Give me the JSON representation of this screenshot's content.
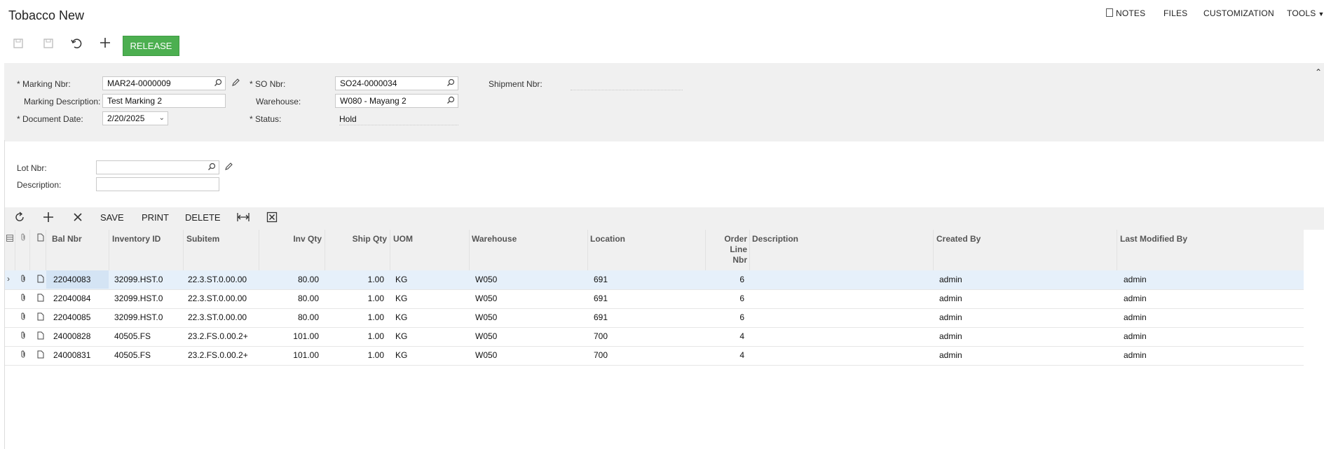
{
  "app": {
    "title": "Tobacco New"
  },
  "top_links": {
    "notes": "NOTES",
    "files": "FILES",
    "customization": "CUSTOMIZATION",
    "tools": "TOOLS"
  },
  "toolbar": {
    "release": "RELEASE"
  },
  "form": {
    "marking_nbr": {
      "label": "Marking Nbr:",
      "value": "MAR24-0000009"
    },
    "marking_desc": {
      "label": "Marking Description:",
      "value": "Test Marking 2"
    },
    "document_date": {
      "label": "Document Date:",
      "value": "2/20/2025"
    },
    "so_nbr": {
      "label": "SO Nbr:",
      "value": "SO24-0000034"
    },
    "warehouse": {
      "label": "Warehouse:",
      "value": "W080 - Mayang 2"
    },
    "status": {
      "label": "Status:",
      "value": "Hold"
    },
    "shipment_nbr": {
      "label": "Shipment Nbr:",
      "value": ""
    },
    "required_mark": "*"
  },
  "filter": {
    "lot_nbr": {
      "label": "Lot Nbr:",
      "value": ""
    },
    "description": {
      "label": "Description:",
      "value": ""
    }
  },
  "grid_toolbar": {
    "save": "SAVE",
    "print": "PRINT",
    "delete": "DELETE"
  },
  "columns": {
    "bal_nbr": "Bal Nbr",
    "inventory_id": "Inventory ID",
    "subitem": "Subitem",
    "inv_qty": "Inv Qty",
    "ship_qty": "Ship Qty",
    "uom": "UOM",
    "warehouse": "Warehouse",
    "location": "Location",
    "order_line_1": "Order",
    "order_line_2": "Line",
    "order_line_3": "Nbr",
    "description": "Description",
    "created_by": "Created By",
    "last_modified_by": "Last Modified By"
  },
  "rows": [
    {
      "bal_nbr": "22040083",
      "inventory_id": "32099.HST.0",
      "subitem": "22.3.ST.0.00.00",
      "inv_qty": "80.00",
      "ship_qty": "1.00",
      "uom": "KG",
      "warehouse": "W050",
      "location": "691",
      "order_line": "6",
      "description": "",
      "created_by": "admin",
      "last_modified_by": "admin"
    },
    {
      "bal_nbr": "22040084",
      "inventory_id": "32099.HST.0",
      "subitem": "22.3.ST.0.00.00",
      "inv_qty": "80.00",
      "ship_qty": "1.00",
      "uom": "KG",
      "warehouse": "W050",
      "location": "691",
      "order_line": "6",
      "description": "",
      "created_by": "admin",
      "last_modified_by": "admin"
    },
    {
      "bal_nbr": "22040085",
      "inventory_id": "32099.HST.0",
      "subitem": "22.3.ST.0.00.00",
      "inv_qty": "80.00",
      "ship_qty": "1.00",
      "uom": "KG",
      "warehouse": "W050",
      "location": "691",
      "order_line": "6",
      "description": "",
      "created_by": "admin",
      "last_modified_by": "admin"
    },
    {
      "bal_nbr": "24000828",
      "inventory_id": "40505.FS",
      "subitem": "23.2.FS.0.00.2+",
      "inv_qty": "101.00",
      "ship_qty": "1.00",
      "uom": "KG",
      "warehouse": "W050",
      "location": "700",
      "order_line": "4",
      "description": "",
      "created_by": "admin",
      "last_modified_by": "admin"
    },
    {
      "bal_nbr": "24000831",
      "inventory_id": "40505.FS",
      "subitem": "23.2.FS.0.00.2+",
      "inv_qty": "101.00",
      "ship_qty": "1.00",
      "uom": "KG",
      "warehouse": "W050",
      "location": "700",
      "order_line": "4",
      "description": "",
      "created_by": "admin",
      "last_modified_by": "admin"
    }
  ]
}
